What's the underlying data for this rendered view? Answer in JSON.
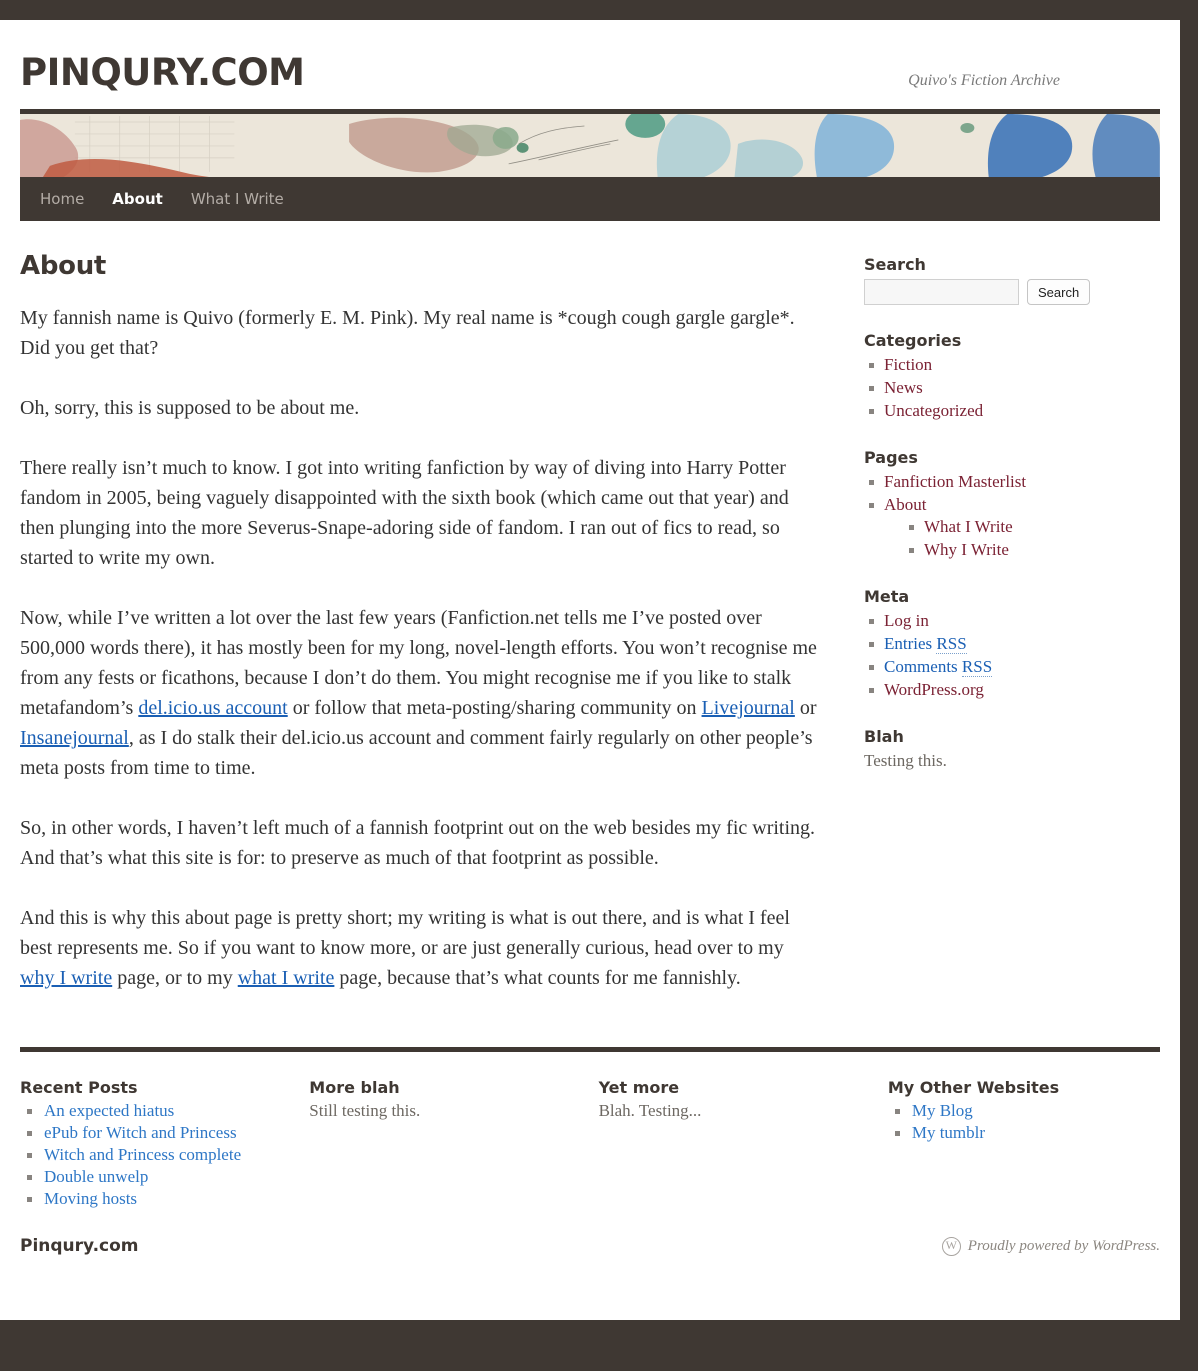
{
  "site": {
    "title": "PINQURY.COM",
    "description": "Quivo's Fiction Archive"
  },
  "nav": {
    "items": [
      {
        "label": "Home",
        "current": false
      },
      {
        "label": "About",
        "current": true
      },
      {
        "label": "What I Write",
        "current": false
      }
    ]
  },
  "page": {
    "title": "About",
    "paragraphs": [
      "My fannish name is Quivo (formerly E. M. Pink). My real name is *cough cough gargle gargle*. Did you get that?",
      "Oh, sorry, this is supposed to be about me.",
      "There really isn’t much to know. I got into writing fanfiction by way of diving into Harry Potter fandom in 2005, being vaguely disappointed with the sixth book (which came out that year) and then plunging into the more Severus-Snape-adoring side of fandom. I ran out of fics to read, so started to write my own."
    ],
    "para4": {
      "a": "Now, while I’ve written a lot over the last few years (Fanfiction.net tells me I’ve posted over 500,000 words there), it has mostly been for my long, novel-length efforts. You won’t recognise me from any fests or ficathons, because I don’t do them. You might recognise me if you like to stalk metafandom’s ",
      "link1": "del.icio.us account",
      "b": " or follow that meta-posting/sharing community on ",
      "link2": "Livejournal",
      "c": " or ",
      "link3": "Insanejournal",
      "d": ", as I do stalk their del.icio.us account and comment fairly regularly on other people’s meta posts from time to time."
    },
    "para5": "So, in other words, I haven’t left much of a fannish footprint out on the web besides my fic writing. And that’s what this site is for: to preserve as much of that footprint as possible.",
    "para6": {
      "a": "And this is why this about page is pretty short; my writing is what is out there, and is what I feel best represents me. So if you want to know more, or are just generally curious, head over to my ",
      "link1": "why I write",
      "b": " page, or to my ",
      "link2": "what I write",
      "c": " page, because that’s what counts for me fannishly."
    }
  },
  "sidebar": {
    "search": {
      "title": "Search",
      "value": "",
      "placeholder": "",
      "button": "Search"
    },
    "categories": {
      "title": "Categories",
      "items": [
        "Fiction",
        "News",
        "Uncategorized"
      ]
    },
    "pages": {
      "title": "Pages",
      "items": [
        "Fanfiction Masterlist",
        "About"
      ],
      "subitems": [
        "What I Write",
        "Why I Write"
      ]
    },
    "meta": {
      "title": "Meta",
      "login": "Log in",
      "entries_rss": {
        "text": "Entries ",
        "abbr": "RSS"
      },
      "comments_rss": {
        "text": "Comments ",
        "abbr": "RSS"
      },
      "wordpress": "WordPress.org"
    },
    "blah": {
      "title": "Blah",
      "text": "Testing this."
    }
  },
  "footer": {
    "columns": [
      {
        "title": "Recent Posts",
        "links": [
          "An expected hiatus",
          "ePub for Witch and Princess",
          "Witch and Princess complete",
          "Double unwelp",
          "Moving hosts"
        ]
      },
      {
        "title": "More blah",
        "text": "Still testing this."
      },
      {
        "title": "Yet more",
        "text": "Blah. Testing..."
      },
      {
        "title": "My Other Websites",
        "links": [
          "My Blog",
          "My tumblr"
        ]
      }
    ],
    "site_name": "Pinqury.com",
    "credit": "Proudly powered by WordPress."
  },
  "colors": {
    "dark": "#3f3833",
    "sidebar_link": "#7b2234",
    "content_link": "#1a5fb4",
    "footer_link": "#2e77c6"
  }
}
